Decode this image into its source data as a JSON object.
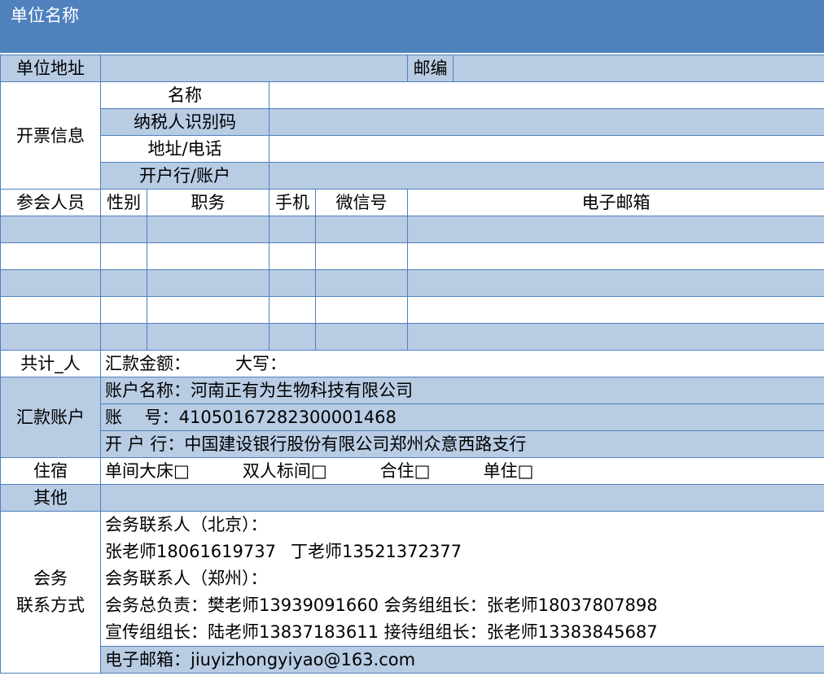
{
  "header": {
    "title": "单位名称"
  },
  "address_row": {
    "label": "单位地址",
    "postcode_label": "邮编"
  },
  "invoice": {
    "label": "开票信息",
    "fields": [
      "名称",
      "纳税人识别码",
      "地址/电话",
      "开户行/账户"
    ]
  },
  "attendees": {
    "label": "参会人员",
    "columns": [
      "性别",
      "职务",
      "手机",
      "微信号",
      "电子邮箱"
    ]
  },
  "total": {
    "label": "共计_人",
    "amount_label": "汇款金额：",
    "capital_label": "大写："
  },
  "remit": {
    "label": "汇款账户",
    "account_name": "账户名称：河南正有为生物科技有限公司",
    "account_no": "账　 号：41050167282300001468",
    "bank": "开 户 行：中国建设银行股份有限公司郑州众意西路支行"
  },
  "lodging": {
    "label": "住宿",
    "options": [
      "单间大床□",
      "双人标间□",
      "合住□",
      "单住□"
    ]
  },
  "other": {
    "label": "其他"
  },
  "contact": {
    "label_line1": "会务",
    "label_line2": "联系方式",
    "beijing_title": "会务联系人（北京）：",
    "beijing_person1": "张老师18061619737",
    "beijing_person2": "丁老师13521372377",
    "zhengzhou_title": "会务联系人（郑州）：",
    "lead": "会务总负责：樊老师13939091660",
    "group_lead": "会务组组长：张老师18037807898",
    "publicity": "宣传组组长：陆老师13837183611",
    "reception": "接待组组长：张老师13383845687",
    "email": "电子邮箱：jiuyizhongyiyao@163.com"
  }
}
